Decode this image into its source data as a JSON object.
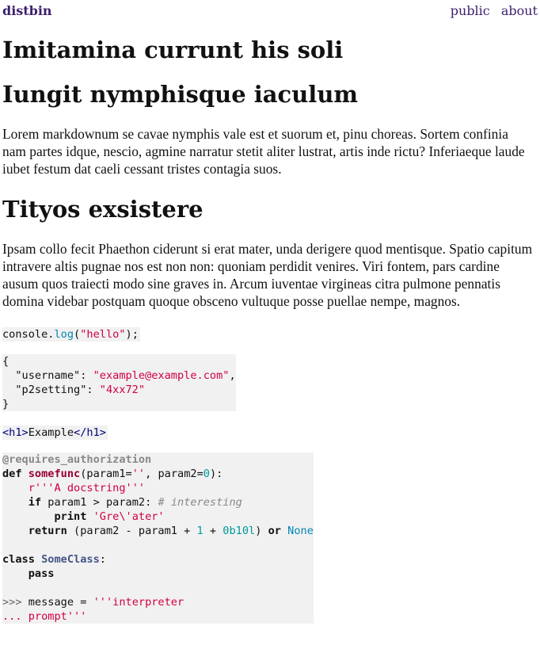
{
  "header": {
    "brand": "distbin",
    "nav": [
      "public",
      "about"
    ]
  },
  "article": {
    "title": "Imitamina currunt his soli",
    "sections": [
      {
        "heading": "Iungit nymphisque iaculum",
        "text": "Lorem markdownum se cavae nymphis vale est et suorum et, pinu choreas. Sortem confinia nam partes idque, nescio, agmine narratur stetit aliter lustrat, artis inde rictu? Inferiaeque laude iubet festum dat caeli cessant tristes contagia suos."
      },
      {
        "heading": "Tityos exsistere",
        "text": "Ipsam collo fecit Phaethon ciderunt si erat mater, unda derigere quod mentisque. Spatio capitum intravere altis pugnae nos est non non: quoniam perdidit venires. Viri fontem, pars cardine ausum quos traiecti modo sine graves in. Arcum iuventae virgineas citra pulmone pennatis domina videbar postquam quoque obsceno vultuque posse puellae nempe, magnos."
      }
    ]
  },
  "code": {
    "js": "console.log(\"hello\");",
    "json": "{\n  \"username\": \"example@example.com\",\n  \"p2setting\": \"4xx72\"\n}",
    "html": "<h1>Example</h1>",
    "python": "@requires_authorization\ndef somefunc(param1='', param2=0):\n    r'''A docstring'''\n    if param1 > param2: # interesting\n        print 'Gre\\'ater'\n    return (param2 - param1 + 1 + 0b10l) or None\n\nclass SomeClass:\n    pass\n\n>>> message = '''interpreter\n... prompt'''"
  },
  "colors": {
    "link": "#3b1f6e",
    "code_bg": "#f1f1f1",
    "string": "#d00040",
    "number": "#009999"
  }
}
